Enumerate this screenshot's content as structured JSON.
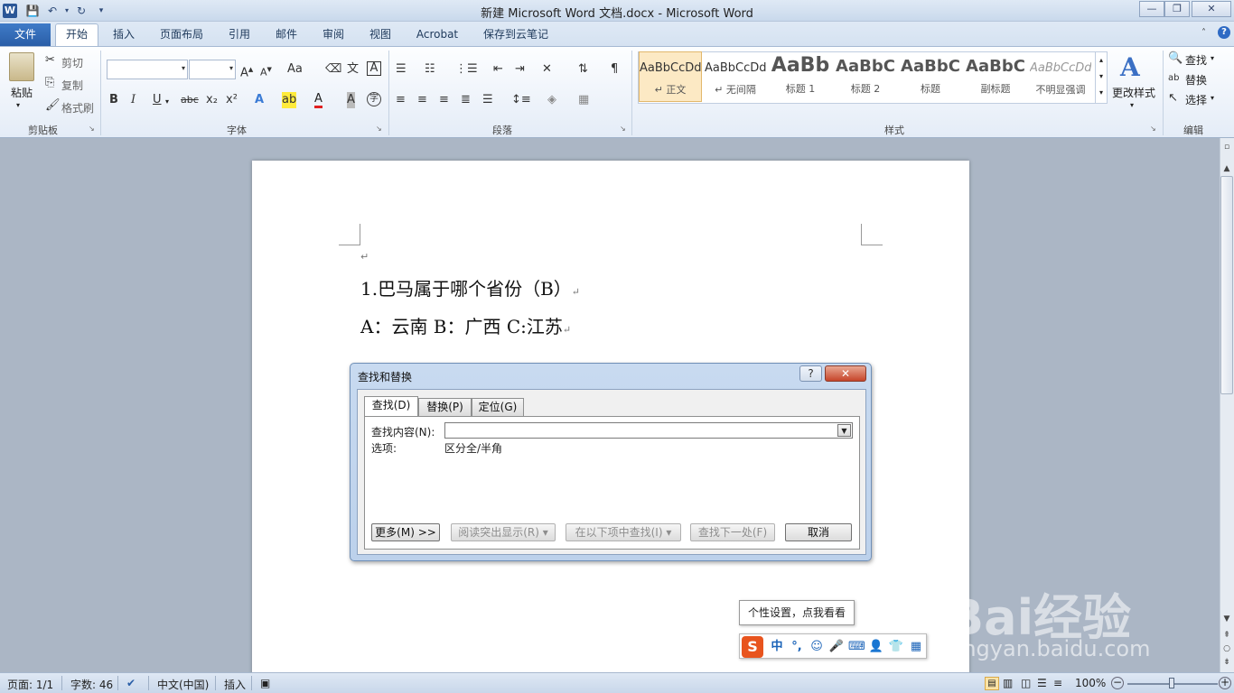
{
  "window": {
    "title": "新建 Microsoft Word 文档.docx  -  Microsoft Word",
    "app_icon": "W"
  },
  "quick_access": {
    "save_icon": "save-icon",
    "undo_icon": "undo-icon",
    "redo_icon": "redo-icon"
  },
  "window_controls": {
    "minimize": "—",
    "restore": "❐",
    "close": "✕"
  },
  "tabs": [
    {
      "label": "文件"
    },
    {
      "label": "开始"
    },
    {
      "label": "插入"
    },
    {
      "label": "页面布局"
    },
    {
      "label": "引用"
    },
    {
      "label": "邮件"
    },
    {
      "label": "审阅"
    },
    {
      "label": "视图"
    },
    {
      "label": "Acrobat"
    },
    {
      "label": "保存到云笔记"
    }
  ],
  "ribbon": {
    "clipboard": {
      "paste": "粘贴",
      "cut": "剪切",
      "copy": "复制",
      "format_painter": "格式刷",
      "group": "剪贴板"
    },
    "font": {
      "group": "字体",
      "font_name": "",
      "font_size": "",
      "bold": "B",
      "italic": "I",
      "underline": "U",
      "strike": "abc",
      "sub": "x₂",
      "sup": "x²"
    },
    "paragraph": {
      "group": "段落"
    },
    "styles": {
      "group": "样式",
      "items": [
        {
          "sample": "AaBbCcDd",
          "name": "↵ 正文"
        },
        {
          "sample": "AaBbCcDd",
          "name": "↵ 无间隔"
        },
        {
          "sample": "AaBb",
          "name": "标题 1"
        },
        {
          "sample": "AaBbC",
          "name": "标题 2"
        },
        {
          "sample": "AaBbC",
          "name": "标题"
        },
        {
          "sample": "AaBbC",
          "name": "副标题"
        },
        {
          "sample": "AaBbCcDd",
          "name": "不明显强调"
        }
      ],
      "change_styles": "更改样式"
    },
    "editing": {
      "group": "编辑",
      "find": "查找",
      "replace": "替换",
      "select": "选择"
    }
  },
  "document": {
    "line1": "1.巴马属于哪个省份（B）",
    "line2": "A：云南 B：广西 C:江苏",
    "para_mark": "↵"
  },
  "dialog": {
    "title": "查找和替换",
    "help": "?",
    "close": "✕",
    "tabs": [
      {
        "label": "查找(D)"
      },
      {
        "label": "替换(P)"
      },
      {
        "label": "定位(G)"
      }
    ],
    "find_label": "查找内容(N):",
    "find_value": "",
    "options_label": "选项:",
    "options_value": "区分全/半角",
    "buttons": {
      "more": "更多(M) >>",
      "reading_highlight": "阅读突出显示(R) ▾",
      "find_in": "在以下项中查找(I) ▾",
      "find_next": "查找下一处(F)",
      "cancel": "取消"
    }
  },
  "ime": {
    "tooltip": "个性设置，点我看看",
    "logo": "S",
    "mode": "中",
    "punct": "°,"
  },
  "status": {
    "page": "页面: 1/1",
    "words": "字数: 46",
    "language": "中文(中国)",
    "mode": "插入",
    "zoom": "100%"
  },
  "watermark": {
    "logo": "Bai经验",
    "url": "jingyan.baidu.com"
  },
  "colors": {
    "accent": "#2a5ea7",
    "dialog_frame": "#bcd1eb",
    "close_red": "#c6452a"
  }
}
